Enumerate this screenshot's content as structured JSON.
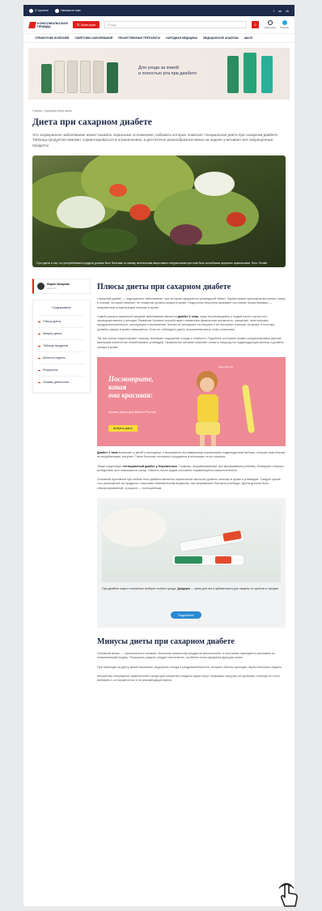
{
  "topbar": {
    "item1": "О проекте",
    "item2": "Напишите нам",
    "socials": [
      "f",
      "ok",
      "vk"
    ]
  },
  "header": {
    "logo_line1": "КОМСОМОЛЬСКАЯ",
    "logo_line2": "ПРАВДА",
    "catalog_label": "Категории",
    "search_placeholder": "Я ищу",
    "icon1_label": "Узнай цены",
    "icon2_label": "Помощь"
  },
  "nav": {
    "items": [
      "СПРАВОЧНИК БОЛЕЗНЕЙ",
      "СИМПТОМЫ ЗАБОЛЕВАНИЙ",
      "ЛЕКАРСТВЕННЫЕ ПРЕПАРАТЫ",
      "НАРОДНАЯ МЕДИЦИНА",
      "МЕДИЦИНСКИЕ АНАЛИЗЫ",
      "ШКОЛ"
    ]
  },
  "banner": {
    "line1": "Для ухода за кожей",
    "line2": "и полостью рта при диабете"
  },
  "breadcrumbs": "Главная / Здоровый образ жизни",
  "article": {
    "title": "Диета при сахарном диабете",
    "lead": "Это эндокринное заболевание может вызвать серьезные осложнения, избежать которых помогает специальная диета при сахарном диабете. Таблица продуктов поможет сориентироваться в ограничениях, а достаточно разнообразное меню на неделе учитывает все запрещенные продукты",
    "hero_caption": "Суть диеты в том, что употребляемые продукты должны быть богатыми по своему питательным веществам и натуральными при этом быть способными прорезать правильными. Фото: Shutter"
  },
  "author": {
    "name": "Мария Захарова",
    "role": "Автор КП"
  },
  "toc": {
    "title": "Содержание",
    "items": [
      "Плюсы диеты",
      "Минусы диеты",
      "Таблица продуктов",
      "Меню на неделю",
      "Результаты",
      "Отзывы диетологов"
    ]
  },
  "section1": {
    "title": "Плюсы диеты при сахарном диабете",
    "p1": "Сахарный диабет — эндокринное заболевание, при котором нарушается углеводный обмен. Характерным признаком выступает сахар в плазме, который означает не снижение уровня сахара в крови. Недостаток инсулина вызывает состояние гипергликемии — повышенной концентрации глюкозы в крови.",
    "p2_a": "Самой распространенной формой заболевания является ",
    "p2_b": "диабет 2 типа",
    "p2_c": ", чаще встречающийся у людей после сорока лет, преимущественно у женщин. Развитию болезни способствуют сниженная физическая активность, ожирение, генетическая предрасположенность, ассоциация и воспаление. Клетки не реагируют на инсулин и не поступает глюкоза, из крови, и поэтому уровень сахара в крови повышается. Если не соблюдать диету, осложнения могут стать опасными.",
    "p3": "Так как клетки недополучают глюкозу, возникает ощущение голода и слабость. Подобное состояние можно скорректировать диетой, уменьшив количество потребляемых углеводов. Правильное питание помогает снизить нагрузку на поджелудочную железу и уровень сахара в крови.",
    "ad_title_1": "Посмотрите,",
    "ad_title_2": "какая",
    "ad_title_3": "она красивая:",
    "ad_sub": "лучшие диеты для жизни в России!",
    "ad_button": "Выбрать диету",
    "ad_logo": "Здоровье КП",
    "p4_a": "Диабет 1 типа",
    "p4_b": " возникает у детей и молодежи, и вызывается аутоиммунным поражением поджелудочной железы, которая практически не вырабатывает инсулин. Такие больные постоянно нуждаются в инъекциях этого гормона.",
    "p5_a": "Также существует ",
    "p5_b": "гестационный диабет у беременных",
    "p5_c": ". Гормоны, вырабатываемые при вынашивании ребенка, блокируют инсулин, вследствие чего повышается сахар. Обычно после родов состояние нормализуется самостоятельно.",
    "p6": "Основной противной при любом типе диабета является ограничение высокой уровень глюкозы в крови и углеводов. Следует кроме того разложение на продукты с высоким гликемическим индексом, так называемые быстрые углеводы. Диета должна быть сбалансированной, а рацион — полноценным.",
    "promo_text_1": "При диабете кожа и слизистые требуют особого ухода. ",
    "promo_text_2": "Диадерм",
    "promo_text_3": " — крем для ног и зубная паста для защиты от сухости и трещин.",
    "promo_button": "Подробнее"
  },
  "section2": {
    "title": "Минусы диеты при сахарном диабете",
    "p1": "Основной минус — ограничения в питании. Больным количеству продуктов желательнее, и постоянно приходится учитывать их гликемический индекс. Расширять рацион следует постепенно, особенно если нарушена функция почек.",
    "p2": "При переходе на диету может возникать ощущение голода и раздражительность, которые обычно проходят через несколько недель.",
    "p3": "Множество популярных заменителей сахара для снижения сладкого вкуса могут оказывать нагрузку на организм, поэтому их стоит выбирать с осторожностью и по рекомендации врача."
  },
  "colors": {
    "brand_red": "#e0201b",
    "navy": "#1e2a4a",
    "ad_pink": "#ee8a96",
    "button_blue": "#2a8ad3"
  }
}
